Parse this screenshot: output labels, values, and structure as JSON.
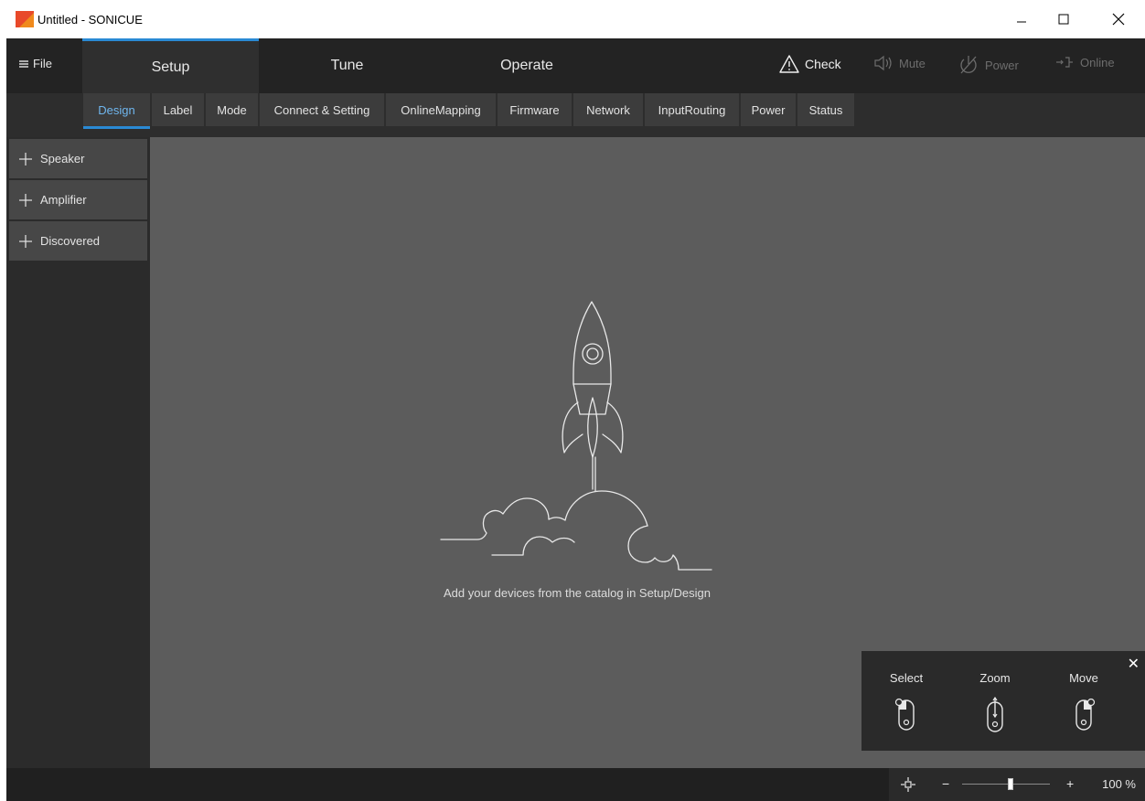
{
  "window": {
    "title": "Untitled - SONICUE",
    "brand_color": "#e8492a"
  },
  "nav": {
    "file_label": "File",
    "tabs": [
      {
        "label": "Setup",
        "active": true
      },
      {
        "label": "Tune",
        "active": false
      },
      {
        "label": "Operate",
        "active": false
      }
    ],
    "actions": {
      "check": "Check",
      "mute": "Mute",
      "power": "Power",
      "online": "Online"
    }
  },
  "subtabs": [
    "Design",
    "Label",
    "Mode",
    "Connect & Setting",
    "OnlineMapping",
    "Firmware",
    "Network",
    "InputRouting",
    "Power",
    "Status"
  ],
  "catalog": {
    "items": [
      "Speaker",
      "Amplifier",
      "Discovered"
    ]
  },
  "canvas": {
    "empty_message": "Add your devices from the catalog in Setup/Design"
  },
  "mouse_help": {
    "select": "Select",
    "zoom": "Zoom",
    "move": "Move"
  },
  "status": {
    "zoom_minus": "−",
    "zoom_plus": "+",
    "zoom_level": "100 %",
    "zoom_slider_fraction": 0.55
  },
  "colors": {
    "accent": "#2a8ad4",
    "canvas": "#5c5c5c"
  }
}
